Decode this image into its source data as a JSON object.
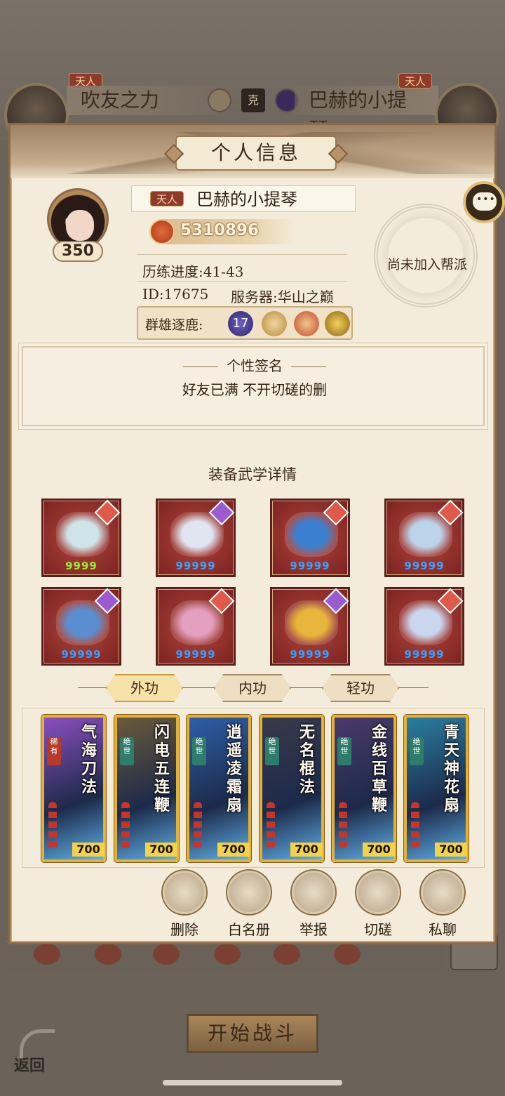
{
  "top": {
    "left_player": {
      "rank": "天人",
      "name": "吹友之力"
    },
    "right_player": {
      "rank": "天人",
      "name": "巴赫的小提琴"
    },
    "vs_label": "克"
  },
  "modal": {
    "title": "个人信息",
    "profile": {
      "level": "350",
      "rank": "天人",
      "name": "巴赫的小提琴",
      "power": "5310896",
      "progress": "历练进度:41-43",
      "id": "ID:17675",
      "server": "服务器:华山之巅",
      "arena_label": "群雄逐鹿:",
      "arena_rank": "17",
      "guild": "尚未加入帮派"
    },
    "signature": {
      "title": "个性签名",
      "text": "好友已满 不开切磋的删"
    },
    "equipment": {
      "title": "装备武学详情",
      "items": [
        {
          "name": "fan-item",
          "level": "9999",
          "color": "#cfe4e8",
          "quality": "#e05a4a"
        },
        {
          "name": "robe-item",
          "level": "99999",
          "color": "#dfe6f2",
          "quality": "#9a5ad0"
        },
        {
          "name": "belt-item",
          "level": "99999",
          "color": "#3b7fd0",
          "quality": "#e05a4a"
        },
        {
          "name": "boots-item",
          "level": "99999",
          "color": "#bcd4ea",
          "quality": "#e05a4a"
        },
        {
          "name": "necklace-item",
          "level": "99999",
          "color": "#5a8ed0",
          "quality": "#9a5ad0"
        },
        {
          "name": "hairpin-item",
          "level": "99999",
          "color": "#e4a0c0",
          "quality": "#e05a4a"
        },
        {
          "name": "ring-gold-item",
          "level": "99999",
          "color": "#e8b63a",
          "quality": "#9a5ad0"
        },
        {
          "name": "ring-silver-item",
          "level": "99999",
          "color": "#c9d6ee",
          "quality": "#e05a4a"
        }
      ]
    },
    "tabs": [
      {
        "label": "外功",
        "active": true
      },
      {
        "label": "内功",
        "active": false
      },
      {
        "label": "轻功",
        "active": false
      }
    ],
    "skills": [
      {
        "name": "气海刀法",
        "grade": "稀有",
        "score": "700",
        "color": "#8a4fbf"
      },
      {
        "name": "闪电五连鞭",
        "grade": "绝世",
        "score": "700",
        "color": "#6a5a3a"
      },
      {
        "name": "逍遥凌霜扇",
        "grade": "绝世",
        "score": "700",
        "color": "#2f5ea8"
      },
      {
        "name": "无名棍法",
        "grade": "绝世",
        "score": "700",
        "color": "#3a3a4a"
      },
      {
        "name": "金线百草鞭",
        "grade": "绝世",
        "score": "700",
        "color": "#4a3a6a"
      },
      {
        "name": "青天神花扇",
        "grade": "绝世",
        "score": "700",
        "color": "#2a7ea0"
      }
    ],
    "actions": [
      {
        "label": "删除",
        "icon": "delete-friend-icon"
      },
      {
        "label": "白名册",
        "icon": "whitelist-book-icon"
      },
      {
        "label": "举报",
        "icon": "report-icon"
      },
      {
        "label": "切磋",
        "icon": "spar-fist-icon"
      },
      {
        "label": "私聊",
        "icon": "chat-icon"
      }
    ]
  },
  "bottom": {
    "start_label": "开始战斗",
    "back_label": "返回"
  }
}
